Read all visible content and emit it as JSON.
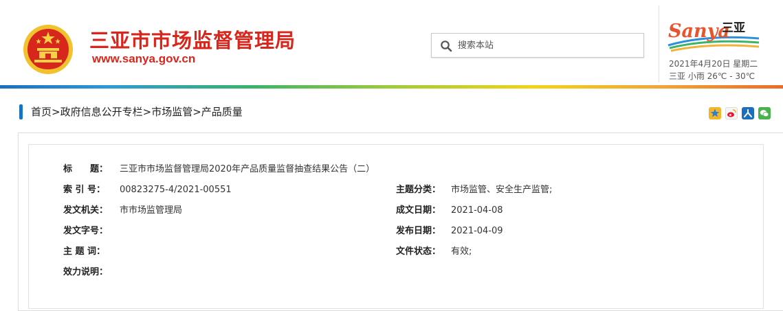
{
  "header": {
    "site_title": "三亚市市场监督管理局",
    "site_url": "www.sanya.gov.cn",
    "search": {
      "placeholder": "搜索本站",
      "icon": "search-icon"
    },
    "date_text": "2021年4月20日 星期二",
    "weather_text": "三亚  小雨  26℃ - 30℃",
    "logo_text": "Sanya",
    "logo_mark": "三亚"
  },
  "breadcrumb": {
    "items": [
      "首页",
      "政府信息公开专栏",
      "市场监管",
      "产品质量"
    ],
    "separator": ">"
  },
  "share_icons": [
    "qzone-icon",
    "weibo-icon",
    "renren-icon",
    "wechat-icon"
  ],
  "info": {
    "title_label": "标　　题：",
    "title_value": "三亚市市场监督管理局2020年产品质量监督抽查结果公告（二）",
    "index_label": "索 引 号：",
    "index_value": "00823275-4/2021-00551",
    "topic_label": "主题分类：",
    "topic_value": "市场监管、安全生产监管;",
    "issuer_label": "发文机关：",
    "issuer_value": "市市场监管理局",
    "created_label": "成文日期：",
    "created_value": "2021-04-08",
    "docno_label": "发文字号：",
    "docno_value": "",
    "published_label": "发布日期：",
    "published_value": "2021-04-09",
    "subject_label": "主 题 词：",
    "subject_value": "",
    "status_label": "文件状态：",
    "status_value": "有效;",
    "validity_label": "效力说明：",
    "validity_value": ""
  },
  "colors": {
    "brand_red": "#d7261b",
    "breadcrumb_bar": "#1a73c2"
  }
}
